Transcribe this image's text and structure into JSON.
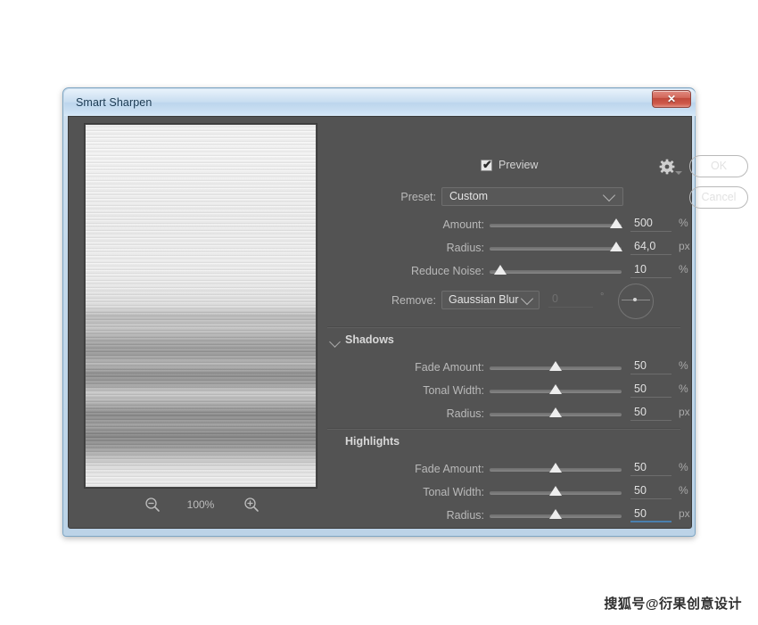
{
  "window": {
    "title": "Smart Sharpen",
    "close_label": "✕"
  },
  "preview": {
    "checkbox_label": "Preview",
    "checked": true,
    "check_glyph": "✔",
    "zoom_level": "100%",
    "zoom_out_icon": "magnifier-minus-icon",
    "zoom_in_icon": "magnifier-plus-icon"
  },
  "actions": {
    "gear_icon": "gear-icon",
    "ok_label": "OK",
    "cancel_label": "Cancel"
  },
  "preset": {
    "label": "Preset:",
    "value": "Custom"
  },
  "sharpen": {
    "amount": {
      "label": "Amount:",
      "value": "500",
      "unit": "%",
      "percent": 96
    },
    "radius": {
      "label": "Radius:",
      "value": "64,0",
      "unit": "px",
      "percent": 96
    },
    "reduce_noise": {
      "label": "Reduce Noise:",
      "value": "10",
      "unit": "%",
      "percent": 8
    }
  },
  "remove": {
    "label": "Remove:",
    "value": "Gaussian Blur",
    "angle_value": "0",
    "angle_unit": "°",
    "angle_dial_icon": "angle-dial-icon"
  },
  "shadows": {
    "title": "Shadows",
    "expanded": true,
    "rows": [
      {
        "label": "Fade Amount:",
        "value": "50",
        "unit": "%",
        "percent": 50,
        "focused": false
      },
      {
        "label": "Tonal Width:",
        "value": "50",
        "unit": "%",
        "percent": 50,
        "focused": false
      },
      {
        "label": "Radius:",
        "value": "50",
        "unit": "px",
        "percent": 50,
        "focused": false
      }
    ]
  },
  "highlights": {
    "title": "Highlights",
    "expanded": true,
    "rows": [
      {
        "label": "Fade Amount:",
        "value": "50",
        "unit": "%",
        "percent": 50,
        "focused": false
      },
      {
        "label": "Tonal Width:",
        "value": "50",
        "unit": "%",
        "percent": 50,
        "focused": false
      },
      {
        "label": "Radius:",
        "value": "50",
        "unit": "px",
        "percent": 50,
        "focused": true
      }
    ]
  },
  "watermark": {
    "text": "搜狐号@衍果创意设计"
  }
}
